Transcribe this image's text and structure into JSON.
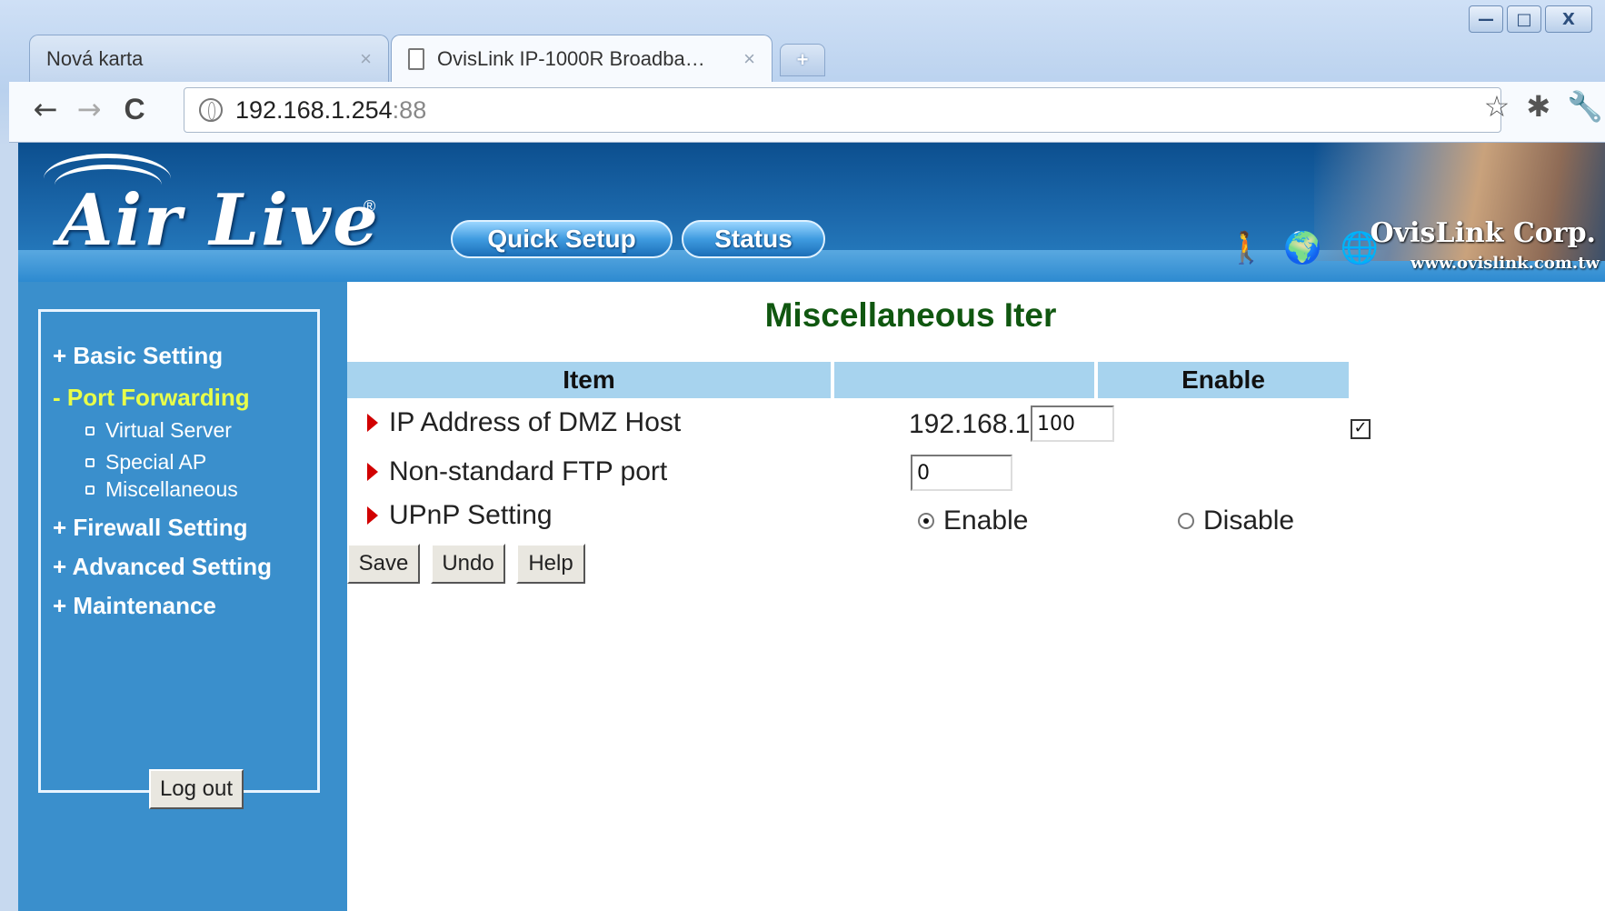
{
  "browser": {
    "tabs": [
      {
        "title": "Nová karta",
        "close": "×"
      },
      {
        "title": "OvisLink IP-1000R Broadba…",
        "close": "×"
      }
    ],
    "new_tab": "+",
    "url_host": "192.168.1.254",
    "url_port": ":88",
    "window_controls": {
      "minimize": "—",
      "maximize": "□",
      "close": "X"
    },
    "nav": {
      "back": "←",
      "forward": "→",
      "reload": "C"
    },
    "tool_icons": {
      "bookmark": "☆",
      "extension": "✱",
      "wrench": "🔧"
    }
  },
  "banner": {
    "logo": "Air Live",
    "logo_mark": "®",
    "quick_setup": "Quick Setup",
    "status": "Status",
    "corp_name": "OvisLink Corp.",
    "corp_url": "www.ovislink.com.tw",
    "icons": [
      "figure-icon",
      "globe-icon",
      "globe-icon"
    ]
  },
  "sidebar": {
    "items": [
      {
        "label": "+ Basic Setting"
      },
      {
        "label": "- Port Forwarding",
        "current": true
      },
      {
        "label": "+ Firewall Setting"
      },
      {
        "label": "+ Advanced Setting"
      },
      {
        "label": "+ Maintenance"
      }
    ],
    "sub_items": [
      "Virtual Server",
      "Special AP",
      "Miscellaneous"
    ],
    "logout": "Log out"
  },
  "content": {
    "title": "Miscellaneous Iter",
    "headers": {
      "item": "Item",
      "value": "",
      "enable": "Enable"
    },
    "rows": {
      "dmz": {
        "label": "IP Address of DMZ Host",
        "prefix": "192.168.1.",
        "value": "100",
        "enabled": true
      },
      "ftp": {
        "label": "Non-standard FTP port",
        "value": "0"
      },
      "upnp": {
        "label": "UPnP Setting",
        "enable_label": "Enable",
        "disable_label": "Disable",
        "selected": "Enable"
      }
    },
    "buttons": {
      "save": "Save",
      "undo": "Undo",
      "help": "Help"
    }
  }
}
